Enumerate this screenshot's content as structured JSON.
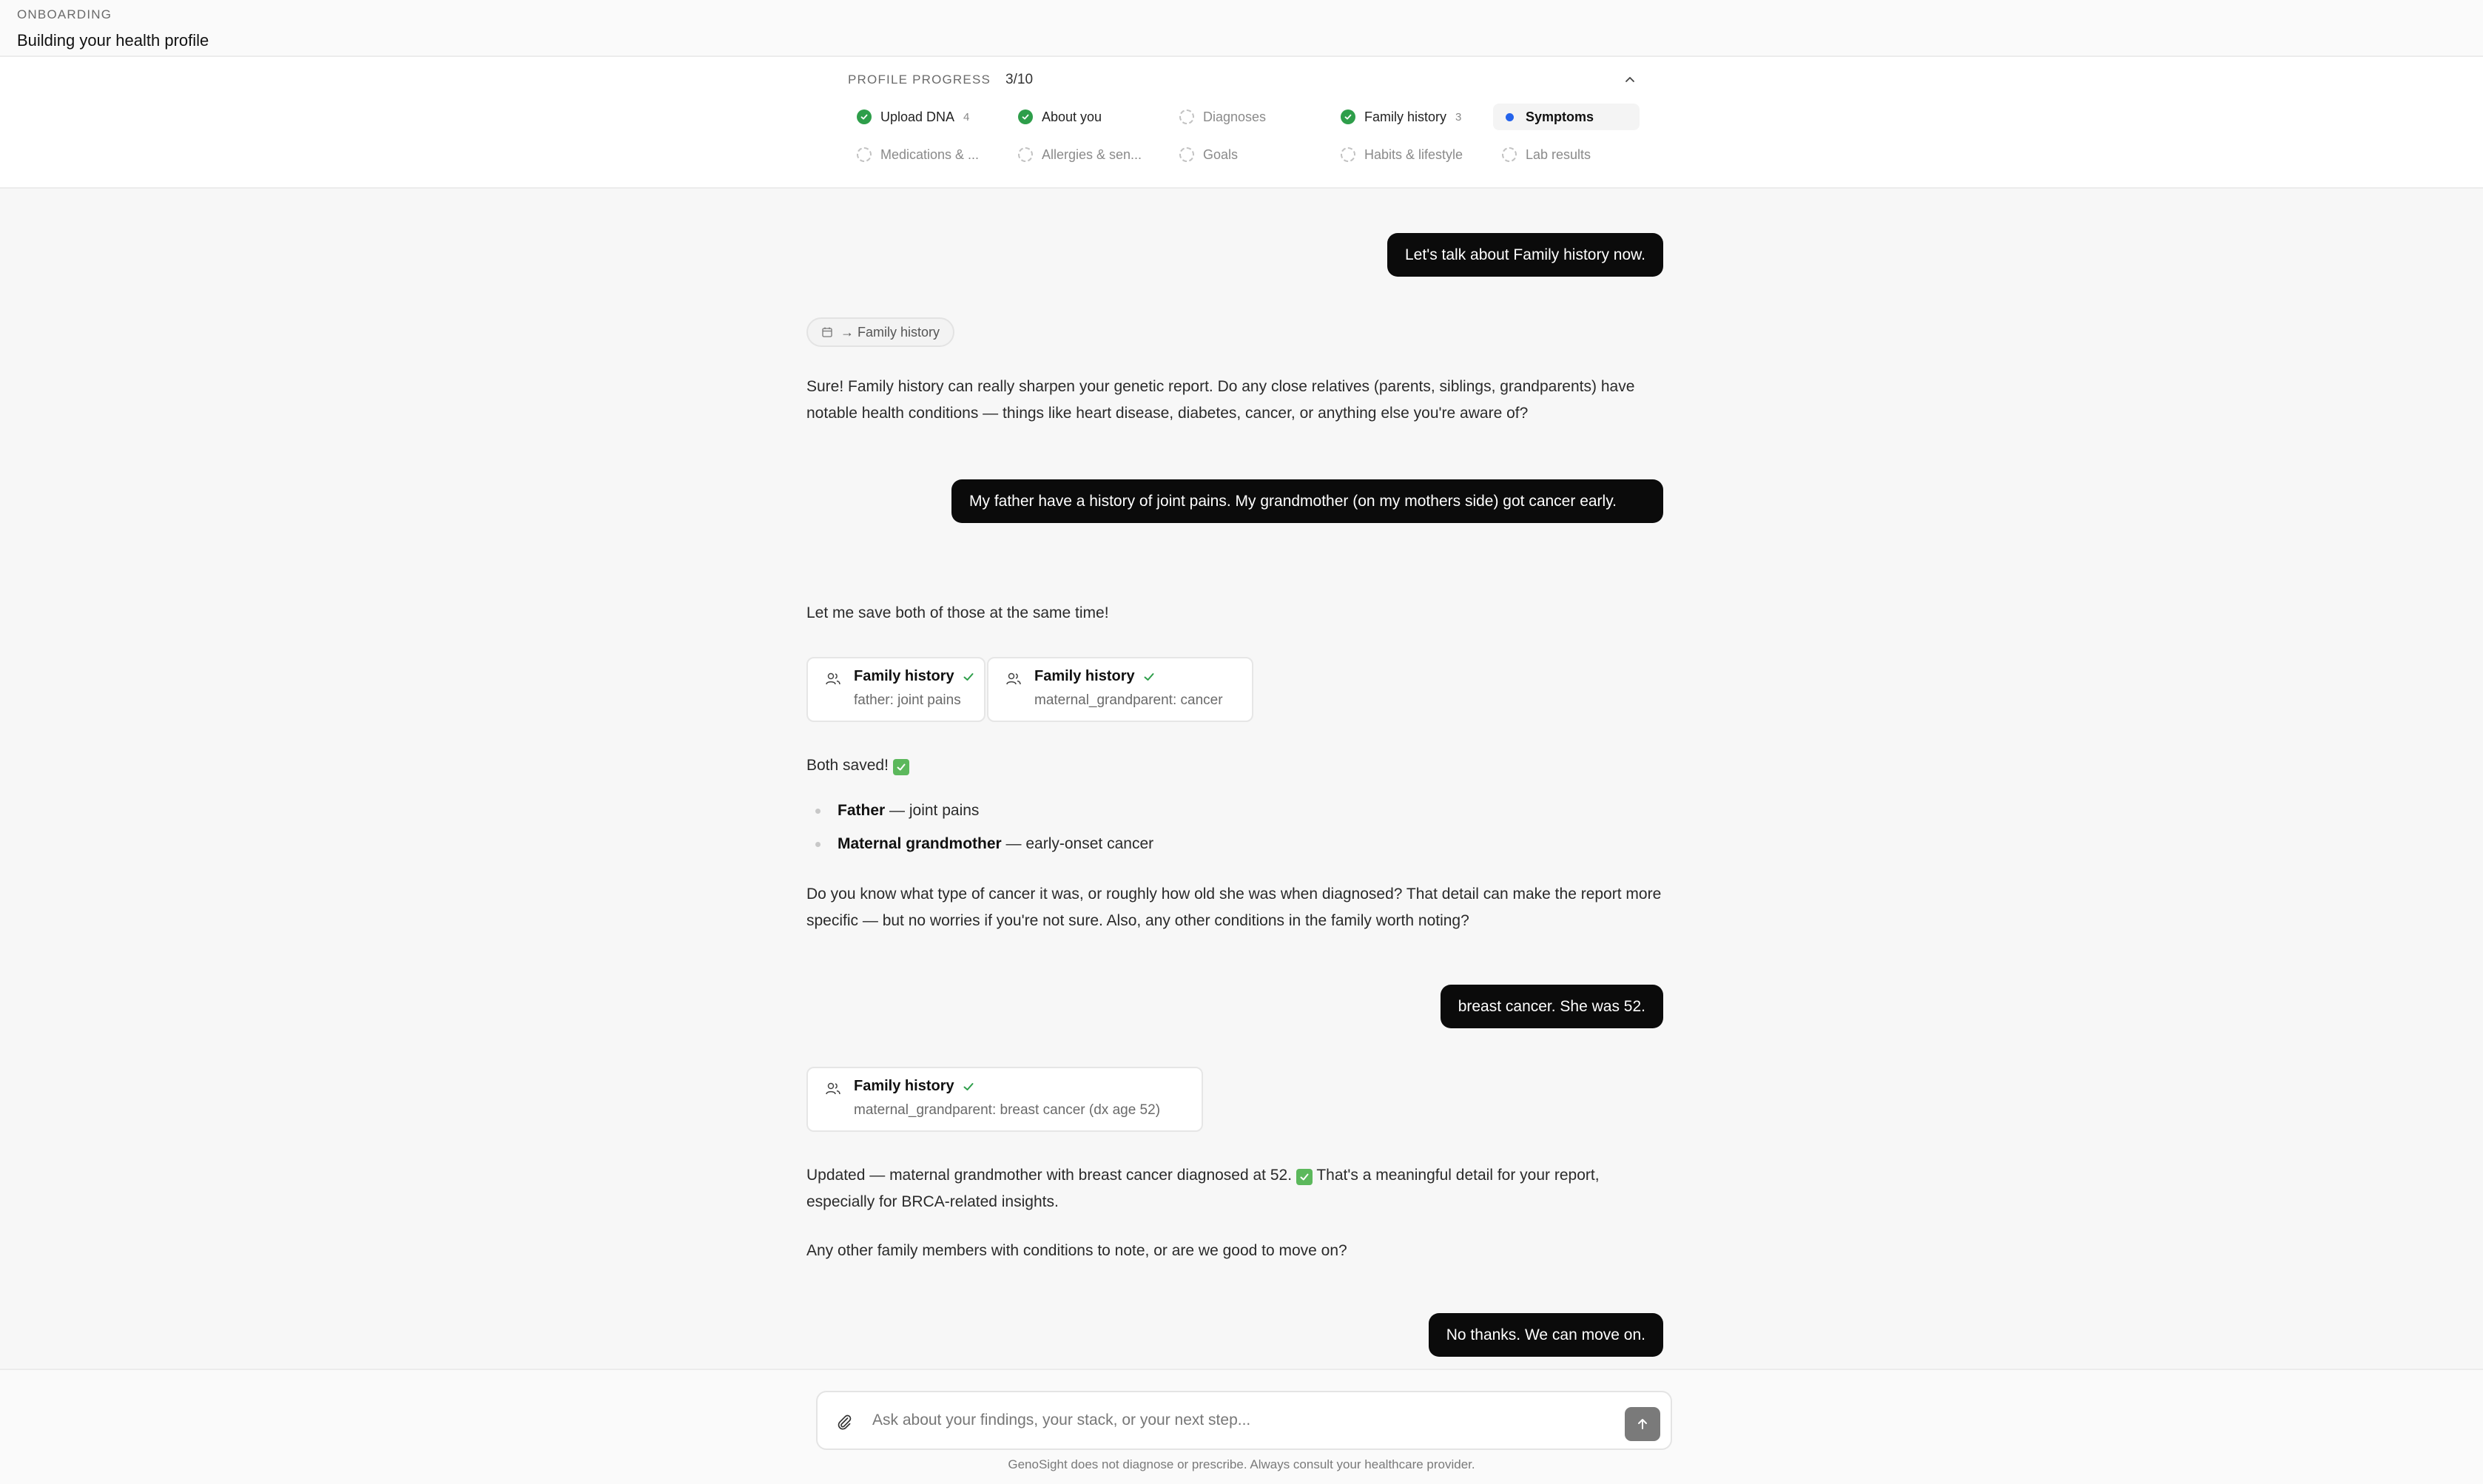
{
  "header": {
    "eyebrow": "ONBOARDING",
    "title": "Building your health profile"
  },
  "progress": {
    "label": "PROFILE PROGRESS",
    "count": "3/10",
    "steps": [
      {
        "label": "Upload DNA",
        "status": "done",
        "badge": "4"
      },
      {
        "label": "About you",
        "status": "done",
        "badge": ""
      },
      {
        "label": "Diagnoses",
        "status": "todo",
        "badge": ""
      },
      {
        "label": "Family history",
        "status": "done",
        "badge": "3"
      },
      {
        "label": "Symptoms",
        "status": "active",
        "badge": ""
      },
      {
        "label": "Medications & ...",
        "status": "todo",
        "badge": ""
      },
      {
        "label": "Allergies & sen...",
        "status": "todo",
        "badge": ""
      },
      {
        "label": "Goals",
        "status": "todo",
        "badge": ""
      },
      {
        "label": "Habits & lifestyle",
        "status": "todo",
        "badge": ""
      },
      {
        "label": "Lab results",
        "status": "todo",
        "badge": ""
      }
    ]
  },
  "chat": {
    "msg1_user": "Let's talk about Family history now.",
    "chip": "→ Family history",
    "msg2_assistant": "Sure! Family history can really sharpen your genetic report. Do any close relatives (parents, siblings, grandparents) have notable health conditions — things like heart disease, diabetes, cancer, or anything else you're aware of?",
    "msg3_user": "My father have a history of joint pains. My grandmother (on my mothers side) got cancer early.",
    "msg4_assistant": "Let me save both of those at the same time!",
    "cards_a": [
      {
        "title": "Family history",
        "sub": "father: joint pains"
      },
      {
        "title": "Family history",
        "sub": "maternal_grandparent: cancer"
      }
    ],
    "saved_text": "Both saved!",
    "bullets": [
      {
        "bold": "Father",
        "rest": " — joint pains"
      },
      {
        "bold": "Maternal grandmother",
        "rest": " — early-onset cancer"
      }
    ],
    "msg5_assistant": "Do you know what type of cancer it was, or roughly how old she was when diagnosed? That detail can make the report more specific — but no worries if you're not sure. Also, any other conditions in the family worth noting?",
    "msg6_user": "breast cancer. She was 52.",
    "card_b": {
      "title": "Family history",
      "sub": "maternal_grandparent: breast cancer (dx age 52)"
    },
    "msg7_assistant_a": "Updated — maternal grandmother with breast cancer diagnosed at 52.",
    "msg7_assistant_b": "That's a meaningful detail for your report, especially for BRCA-related insights.",
    "msg8_assistant": "Any other family members with conditions to note, or are we good to move on?",
    "msg9_user": "No thanks. We can move on."
  },
  "composer": {
    "placeholder": "Ask about your findings, your stack, or your next step...",
    "disclaimer": "GenoSight does not diagnose or prescribe. Always consult your healthcare provider."
  },
  "colors": {
    "done": "#2e9e4a",
    "active": "#2463eb",
    "user_bubble": "#0b0b0b"
  },
  "icons": [
    "chevron-up-icon",
    "check-circle-icon",
    "calendar-icon",
    "people-icon",
    "checkmark-icon",
    "paperclip-icon",
    "arrow-up-icon"
  ]
}
